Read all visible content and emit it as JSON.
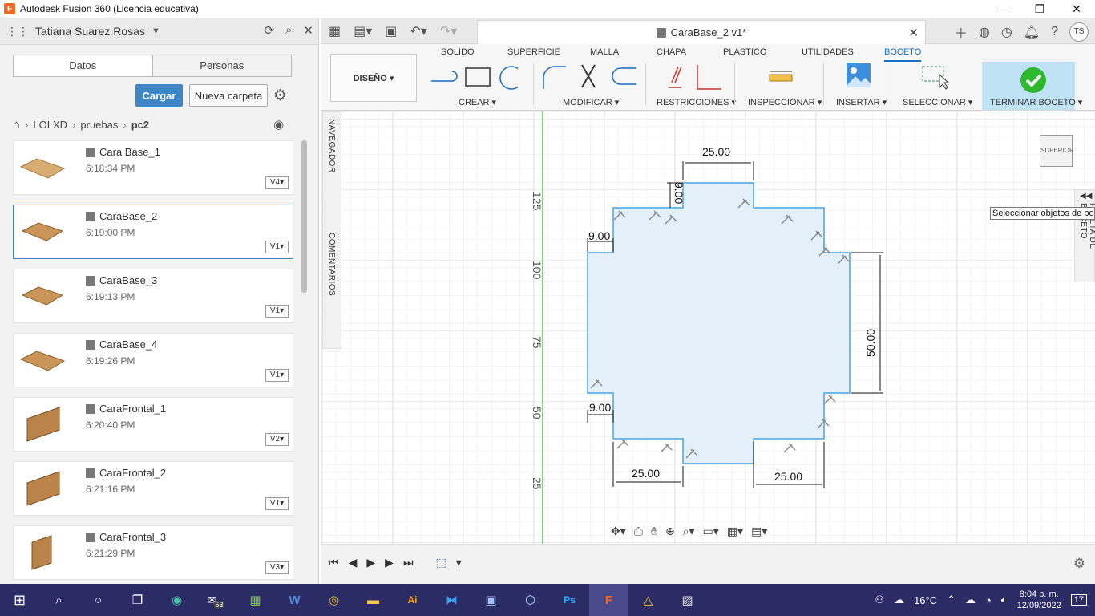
{
  "window": {
    "title": "Autodesk Fusion 360 (Licencia educativa)",
    "app_letter": "F",
    "minimize": "—",
    "maximize": "❐",
    "close": "✕"
  },
  "data_panel": {
    "user": "Tatiana Suarez Rosas",
    "tabs": [
      "Datos",
      "Personas"
    ],
    "upload_button": "Cargar",
    "new_folder_button": "Nueva carpeta",
    "breadcrumb": [
      "LOLXD",
      "pruebas",
      "pc2"
    ],
    "files": [
      {
        "name": "Cara Base_1",
        "time": "6:18:34 PM",
        "version": "V4▾",
        "selected": false
      },
      {
        "name": "CaraBase_2",
        "time": "6:19:00 PM",
        "version": "V1▾",
        "selected": true
      },
      {
        "name": "CaraBase_3",
        "time": "6:19:13 PM",
        "version": "V1▾",
        "selected": false
      },
      {
        "name": "CaraBase_4",
        "time": "6:19:26 PM",
        "version": "V1▾",
        "selected": false
      },
      {
        "name": "CaraFrontal_1",
        "time": "6:20:40 PM",
        "version": "V2▾",
        "selected": false
      },
      {
        "name": "CaraFrontal_2",
        "time": "6:21:16 PM",
        "version": "V1▾",
        "selected": false
      },
      {
        "name": "CaraFrontal_3",
        "time": "6:21:29 PM",
        "version": "V3▾",
        "selected": false
      }
    ]
  },
  "document_tab": {
    "title": "CaraBase_2 v1*"
  },
  "user_initials": "TS",
  "ribbon": {
    "workspace": "DISEÑO ▾",
    "tabs": [
      "SOLIDO",
      "SUPERFICIE",
      "MALLA",
      "CHAPA",
      "PLÁSTICO",
      "UTILIDADES",
      "BOCETO"
    ],
    "active_tab": "BOCETO",
    "groups": [
      "CREAR ▾",
      "MODIFICAR ▾",
      "RESTRICCIONES ▾",
      "INSPECCIONAR ▾",
      "INSERTAR ▾",
      "SELECCIONAR ▾",
      "TERMINAR BOCETO ▾"
    ]
  },
  "side_labels": {
    "navigator": "NAVEGADOR",
    "comments": "COMENTARIOS",
    "sketch_palette": "PALETA DE BOCETO"
  },
  "tooltip": "Seleccionar objetos de boceto",
  "viewcube": "SUPERIOR",
  "axis_labels": [
    "125",
    "100",
    "75",
    "50",
    "25"
  ],
  "dimensions": [
    "25.00",
    "9.00",
    "9.00",
    "50.00",
    "9.00",
    "25.00",
    "25.00"
  ],
  "colors": {
    "accent": "#1a6dc0",
    "sketch_fill": "#e3eff9",
    "sketch_line": "#4aa3df",
    "finish_check": "#2eb82e",
    "taskbar": "#2b2b66"
  },
  "taskbar": {
    "badge": "53",
    "temperature": "16°C",
    "time": "8:04 p. m.",
    "date": "12/09/2022",
    "notifications": "17"
  }
}
